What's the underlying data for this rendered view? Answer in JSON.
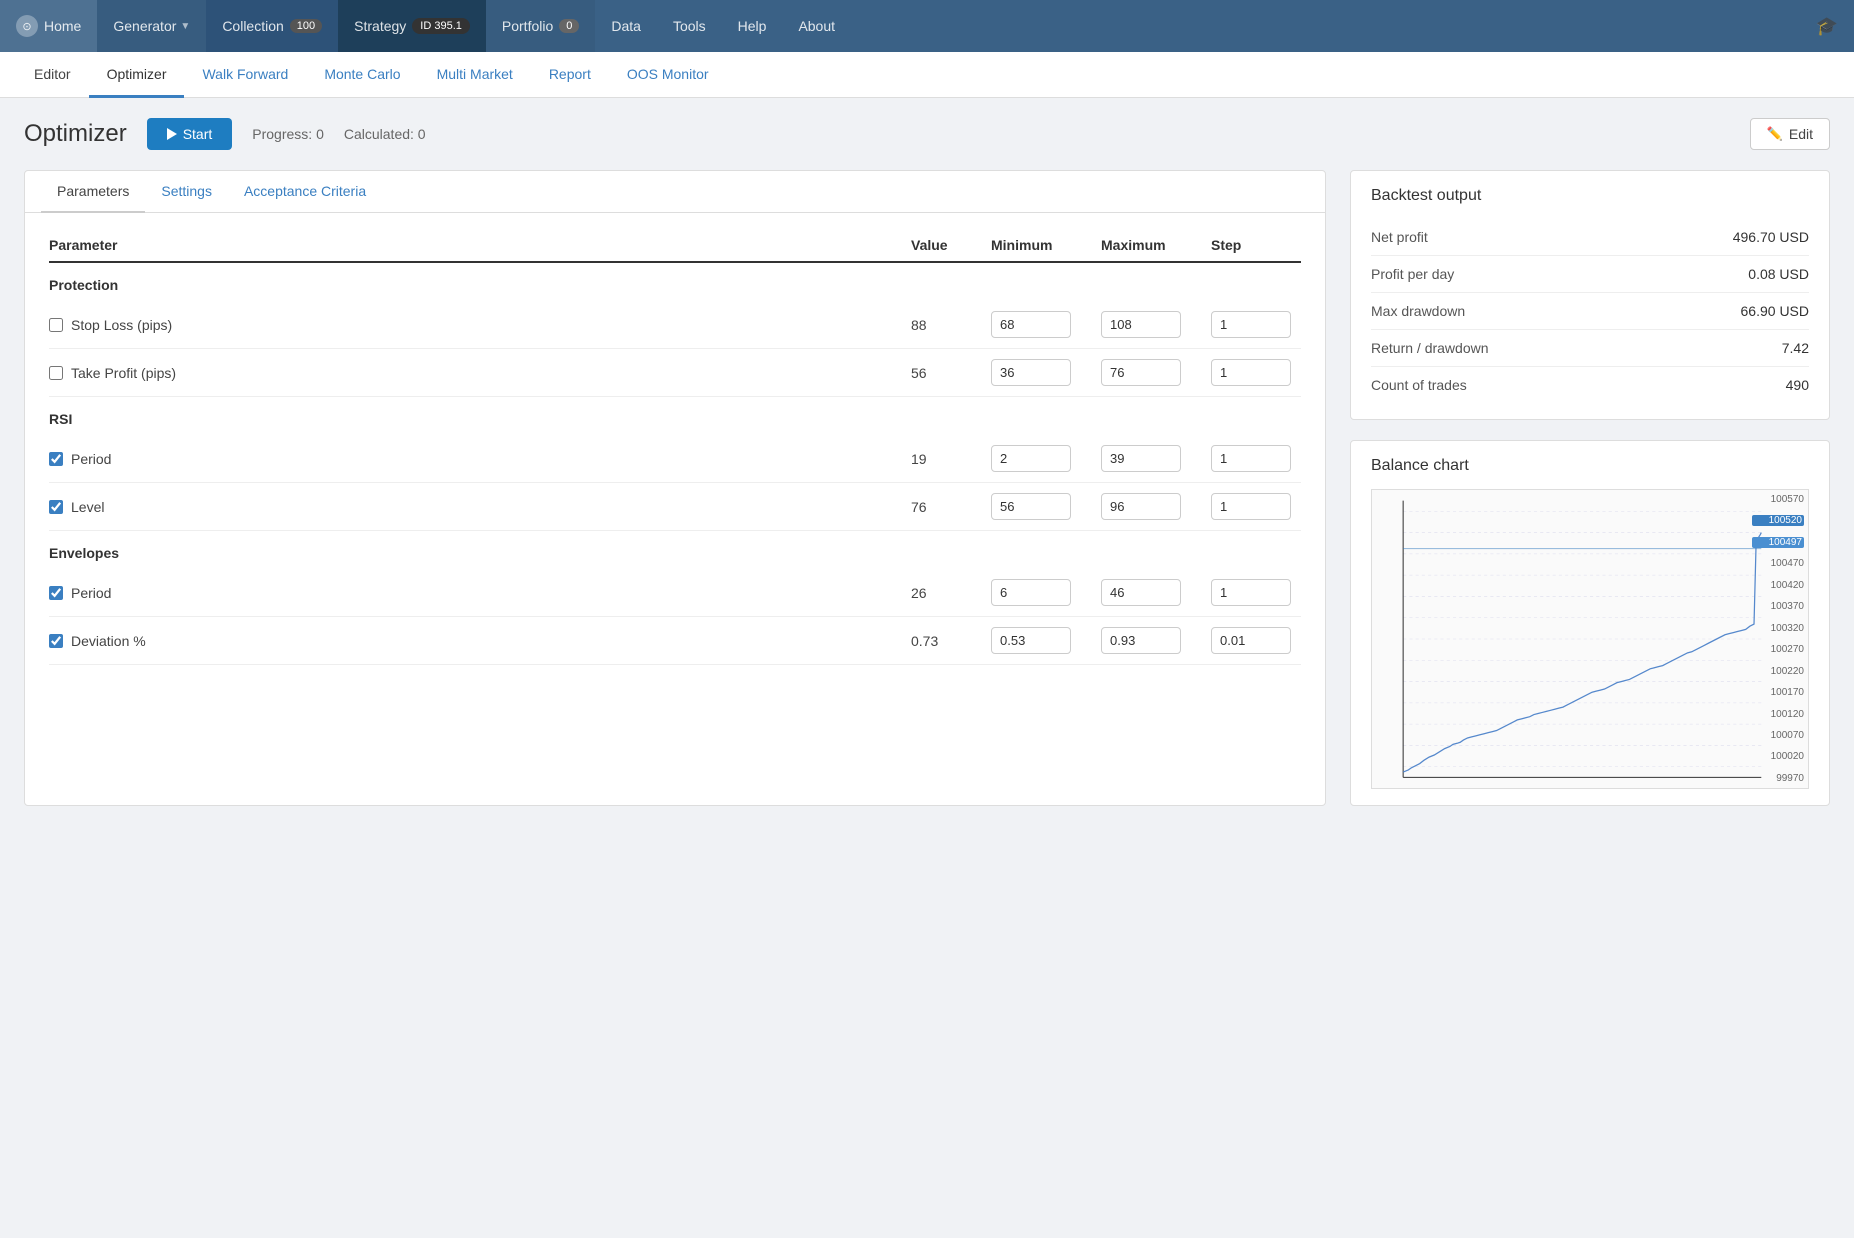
{
  "topNav": {
    "home_label": "Home",
    "generator_label": "Generator",
    "collection_label": "Collection",
    "collection_badge": "100",
    "strategy_label": "Strategy",
    "strategy_id": "ID 395.1",
    "portfolio_label": "Portfolio",
    "portfolio_badge": "0",
    "data_label": "Data",
    "tools_label": "Tools",
    "help_label": "Help",
    "about_label": "About"
  },
  "subNav": {
    "editor_label": "Editor",
    "optimizer_label": "Optimizer",
    "walk_forward_label": "Walk Forward",
    "monte_carlo_label": "Monte Carlo",
    "multi_market_label": "Multi Market",
    "report_label": "Report",
    "oos_monitor_label": "OOS Monitor"
  },
  "toolbar": {
    "title": "Optimizer",
    "start_label": "Start",
    "progress_label": "Progress: 0",
    "calculated_label": "Calculated: 0",
    "edit_label": "Edit"
  },
  "panelTabs": {
    "parameters_label": "Parameters",
    "settings_label": "Settings",
    "acceptance_criteria_label": "Acceptance Criteria"
  },
  "paramsHeader": {
    "parameter": "Parameter",
    "value": "Value",
    "minimum": "Minimum",
    "maximum": "Maximum",
    "step": "Step"
  },
  "paramSections": [
    {
      "section": "Protection",
      "params": [
        {
          "name": "Stop Loss (pips)",
          "checked": false,
          "value": "88",
          "min": "68",
          "max": "108",
          "step": "1"
        },
        {
          "name": "Take Profit (pips)",
          "checked": false,
          "value": "56",
          "min": "36",
          "max": "76",
          "step": "1"
        }
      ]
    },
    {
      "section": "RSI",
      "params": [
        {
          "name": "Period",
          "checked": true,
          "value": "19",
          "min": "2",
          "max": "39",
          "step": "1"
        },
        {
          "name": "Level",
          "checked": true,
          "value": "76",
          "min": "56",
          "max": "96",
          "step": "1"
        }
      ]
    },
    {
      "section": "Envelopes",
      "params": [
        {
          "name": "Period",
          "checked": true,
          "value": "26",
          "min": "6",
          "max": "46",
          "step": "1"
        },
        {
          "name": "Deviation %",
          "checked": true,
          "value": "0.73",
          "min": "0.53",
          "max": "0.93",
          "step": "0.01"
        }
      ]
    }
  ],
  "backtestOutput": {
    "title": "Backtest output",
    "metrics": [
      {
        "label": "Net profit",
        "value": "496.70 USD"
      },
      {
        "label": "Profit per day",
        "value": "0.08 USD"
      },
      {
        "label": "Max drawdown",
        "value": "66.90 USD"
      },
      {
        "label": "Return / drawdown",
        "value": "7.42"
      },
      {
        "label": "Count of trades",
        "value": "490"
      }
    ]
  },
  "balanceChart": {
    "title": "Balance chart",
    "yLabels": [
      "100570",
      "100520",
      "100497",
      "100470",
      "100420",
      "100370",
      "100320",
      "100270",
      "100220",
      "100170",
      "100120",
      "100070",
      "100020",
      "99970"
    ],
    "highlightValue": "100497",
    "highlightValue2": "100520"
  }
}
